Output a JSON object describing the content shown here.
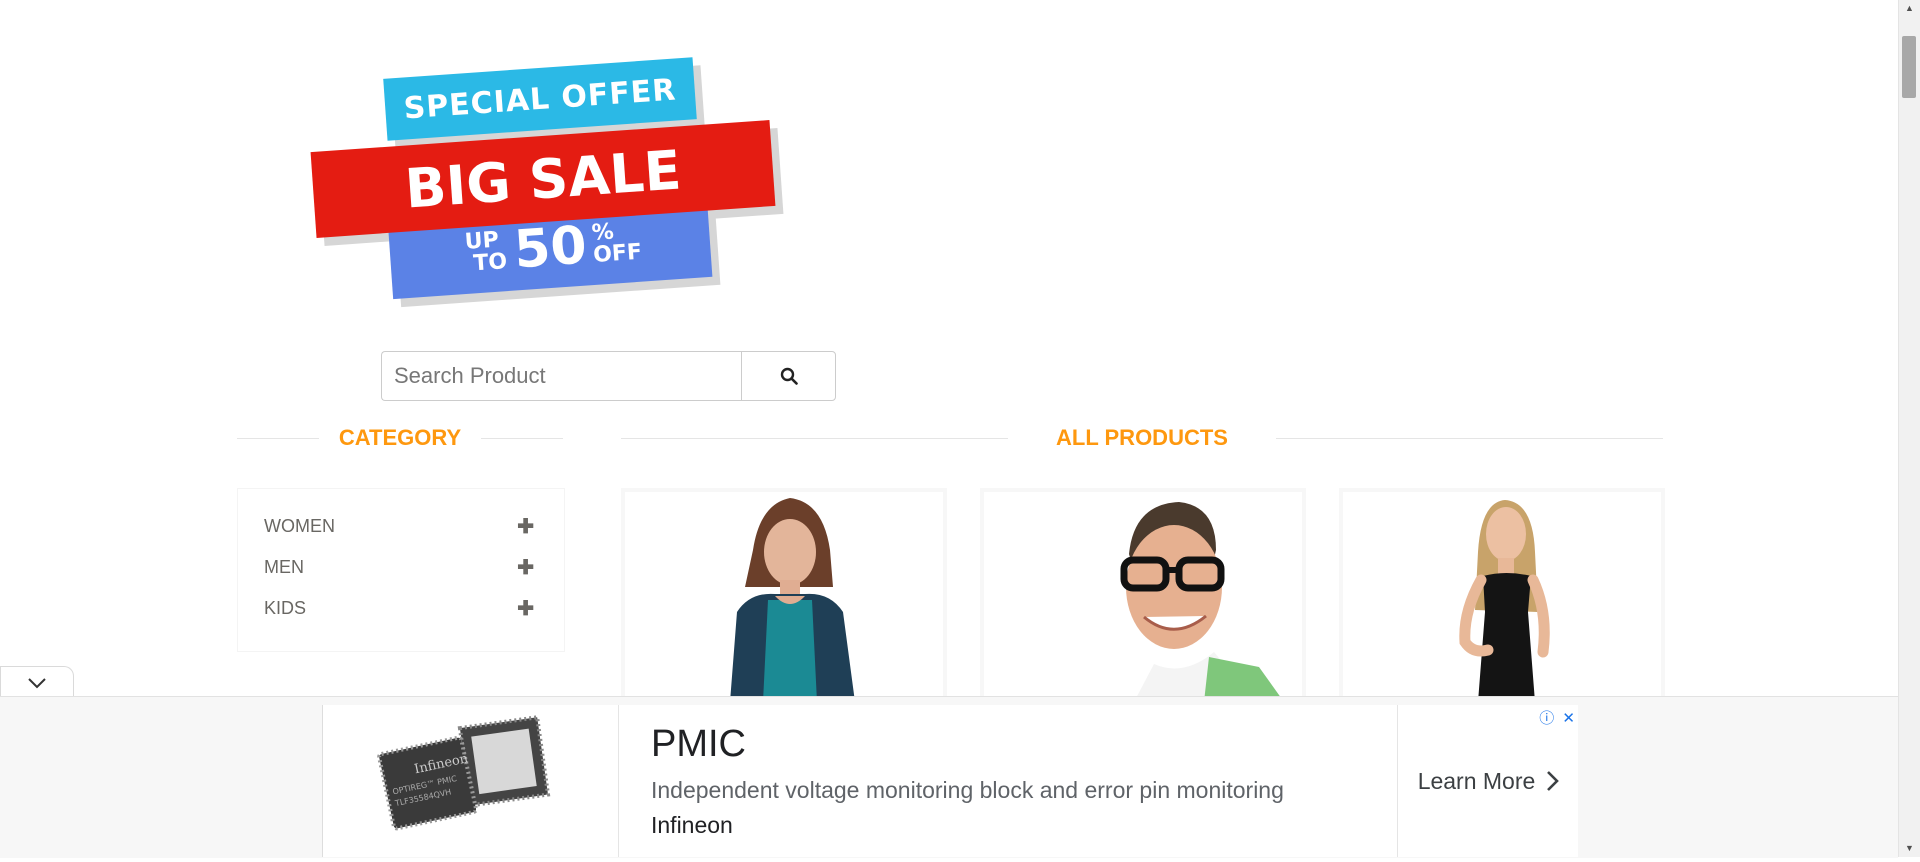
{
  "banner": {
    "line1": "SPECIAL OFFER",
    "line2": "BIG SALE",
    "up": "UP",
    "to": "TO",
    "number": "50",
    "percent": "%",
    "off": "OFF"
  },
  "search": {
    "placeholder": "Search Product",
    "icon": "search-icon"
  },
  "sections": {
    "category": "CATEGORY",
    "all_products": "ALL PRODUCTS"
  },
  "categories": [
    {
      "label": "WOMEN",
      "icon": "plus-icon"
    },
    {
      "label": "MEN",
      "icon": "plus-icon"
    },
    {
      "label": "KIDS",
      "icon": "plus-icon"
    }
  ],
  "products": [
    {
      "image": "woman-teal-top"
    },
    {
      "image": "man-glasses"
    },
    {
      "image": "woman-black-dress"
    }
  ],
  "ad": {
    "product_label": "Infineon",
    "chip_text1": "OPTIREG™ PMIC",
    "chip_text2": "TLF35584QVH",
    "title": "PMIC",
    "description": "Independent voltage monitoring block and error pin monitoring",
    "advertiser": "Infineon",
    "cta": "Learn More"
  },
  "colors": {
    "accent": "#fe980f",
    "sale_red": "#e41c12",
    "sale_cyan": "#2bb9e6",
    "sale_blue": "#5b82e6"
  }
}
